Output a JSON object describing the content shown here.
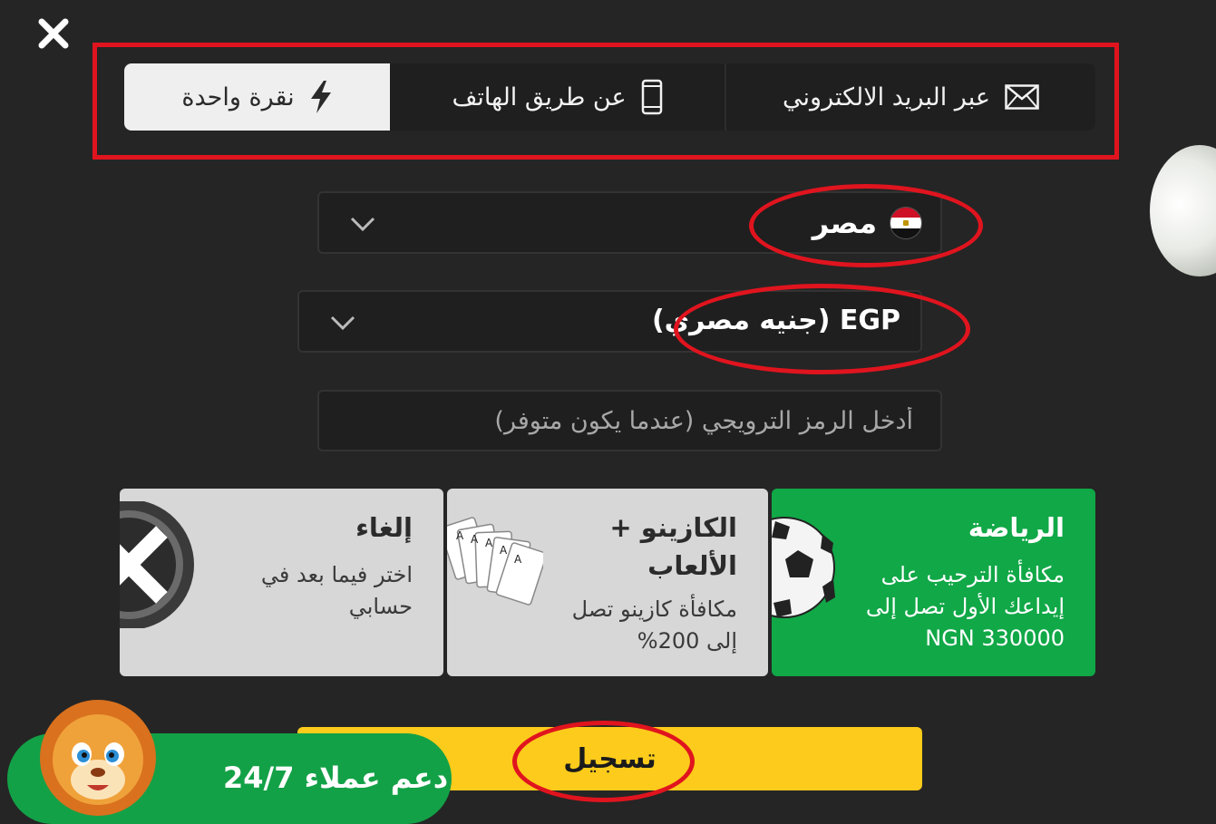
{
  "tabs": [
    {
      "label": "نقرة واحدة",
      "icon": "lightning-icon",
      "active": true
    },
    {
      "label": "عن طريق الهاتف",
      "icon": "phone-icon",
      "active": false
    },
    {
      "label": "عبر البريد الالكتروني",
      "icon": "envelope-icon",
      "active": false
    }
  ],
  "country": {
    "value": "مصر",
    "flag": "egypt-flag-icon"
  },
  "currency": {
    "value": "EGP (جنيه مصري)"
  },
  "promo": {
    "placeholder": "أدخل الرمز الترويجي (عندما يكون متوفر)"
  },
  "bonuses": [
    {
      "title": "الرياضة",
      "description": "مكافأة الترحيب على إيداعك الأول تصل إلى NGN 330000",
      "icon": "soccer-ball-icon",
      "color": "#11a847"
    },
    {
      "title": "الكازينو + الألعاب",
      "description": "مكافأة كازينو تصل إلى 200%",
      "icon": "playing-cards-icon",
      "color": "#d7d7d7"
    },
    {
      "title": "إلغاء",
      "description": "اختر فيما بعد في حسابي",
      "icon": "cancel-x-icon",
      "color": "#d7d7d7"
    }
  ],
  "register": {
    "label": "تسجيل",
    "color": "#fdcb1b"
  },
  "support": {
    "label": "دعم عملاء 24/7",
    "color": "#13a147"
  },
  "annotations": {
    "color": "#e0141e"
  }
}
